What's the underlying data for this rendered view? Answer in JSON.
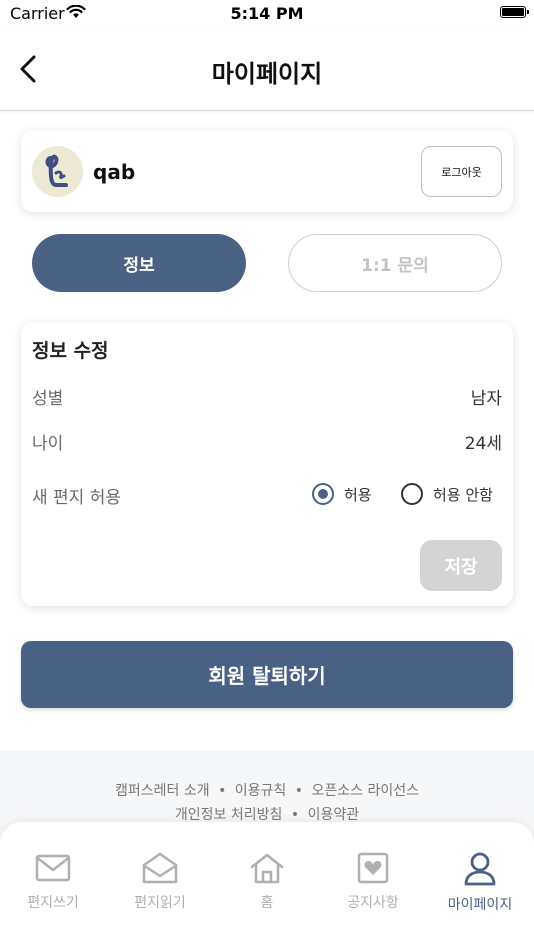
{
  "status": {
    "carrier": "Carrier",
    "time": "5:14 PM"
  },
  "header": {
    "title": "마이페이지"
  },
  "profile": {
    "username": "qab",
    "logout_label": "로그아웃"
  },
  "tabs": [
    {
      "label": "정보",
      "active": true
    },
    {
      "label": "1:1 문의",
      "active": false
    }
  ],
  "edit": {
    "title": "정보 수정",
    "gender_label": "성별",
    "gender_value": "남자",
    "age_label": "나이",
    "age_value": "24세",
    "letter_label": "새 편지 허용",
    "allow_label": "허용",
    "deny_label": "허용 안함",
    "allow_letters": true,
    "save_label": "저장"
  },
  "withdraw_label": "회원 탈퇴하기",
  "footer": {
    "link_about": "캠퍼스레터 소개",
    "link_rules": "이용규칙",
    "link_opensource": "오픈소스 라이선스",
    "link_privacy": "개인정보 처리방침",
    "link_terms": "이용약관",
    "separator": "•"
  },
  "tabbar": [
    {
      "label": "편지쓰기",
      "icon": "envelope-icon"
    },
    {
      "label": "편지읽기",
      "icon": "open-envelope-icon"
    },
    {
      "label": "홈",
      "icon": "home-icon"
    },
    {
      "label": "공지사항",
      "icon": "heart-frame-icon"
    },
    {
      "label": "마이페이지",
      "icon": "user-icon",
      "active": true
    }
  ],
  "colors": {
    "primary": "#4a6186",
    "inactive": "#b0b0b0",
    "save_disabled": "#d4d4d4"
  }
}
